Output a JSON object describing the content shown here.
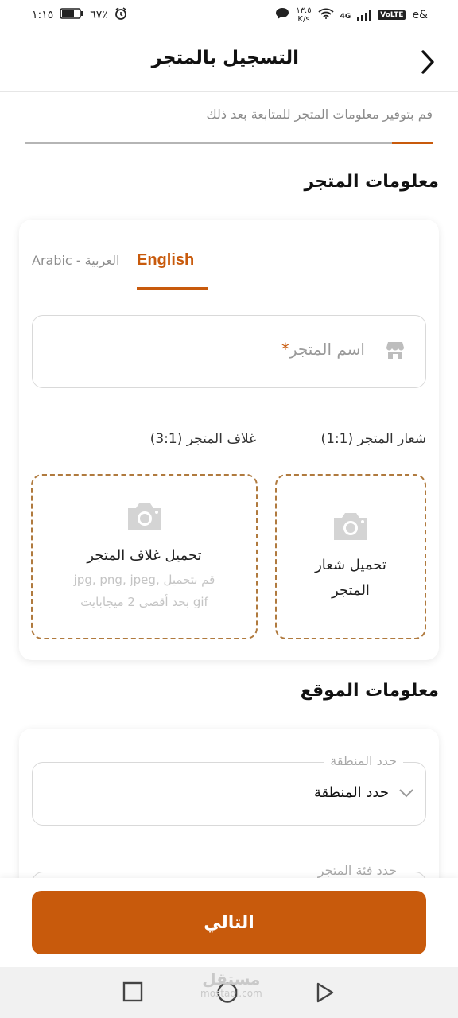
{
  "status_bar": {
    "time": "١:١٥",
    "battery": "٦٧٪",
    "speed_value": "١٣.٥",
    "speed_unit": "K/s",
    "network": "4G",
    "volte": "VoLTE",
    "carrier": "e&"
  },
  "header": {
    "title": "التسجيل بالمتجر"
  },
  "intro": {
    "subtitle": "قم بتوفير معلومات المتجر للمتابعة بعد ذلك",
    "progress": 0.1
  },
  "store_info": {
    "section_title": "معلومات المتجر",
    "tabs": {
      "english": "English",
      "arabic": "Arabic - العربية"
    },
    "name_field": {
      "placeholder": "اسم المتجر",
      "required_mark": "*"
    },
    "logo": {
      "label": "شعار المتجر (1:1)",
      "upload_title_line1": "تحميل شعار",
      "upload_title_line2": "المتجر"
    },
    "cover": {
      "label": "غلاف المتجر (3:1)",
      "upload_title": "تحميل غلاف المتجر",
      "hint_line1": "قم بتحميل ,jpg, png, jpeg",
      "hint_line2": "gif بحد أقصى 2 ميجابايت"
    }
  },
  "location_info": {
    "section_title": "معلومات الموقع",
    "region_field": {
      "label": "حدد المنطقة",
      "value": "حدد المنطقة"
    },
    "category_field": {
      "label": "حدد فئة المتجر"
    }
  },
  "footer": {
    "next_label": "التالي"
  },
  "watermark": {
    "arabic": "مستقل",
    "latin": "mostaql.com"
  },
  "colors": {
    "accent": "#c85a0c",
    "dashed_border": "#b07a3e"
  }
}
